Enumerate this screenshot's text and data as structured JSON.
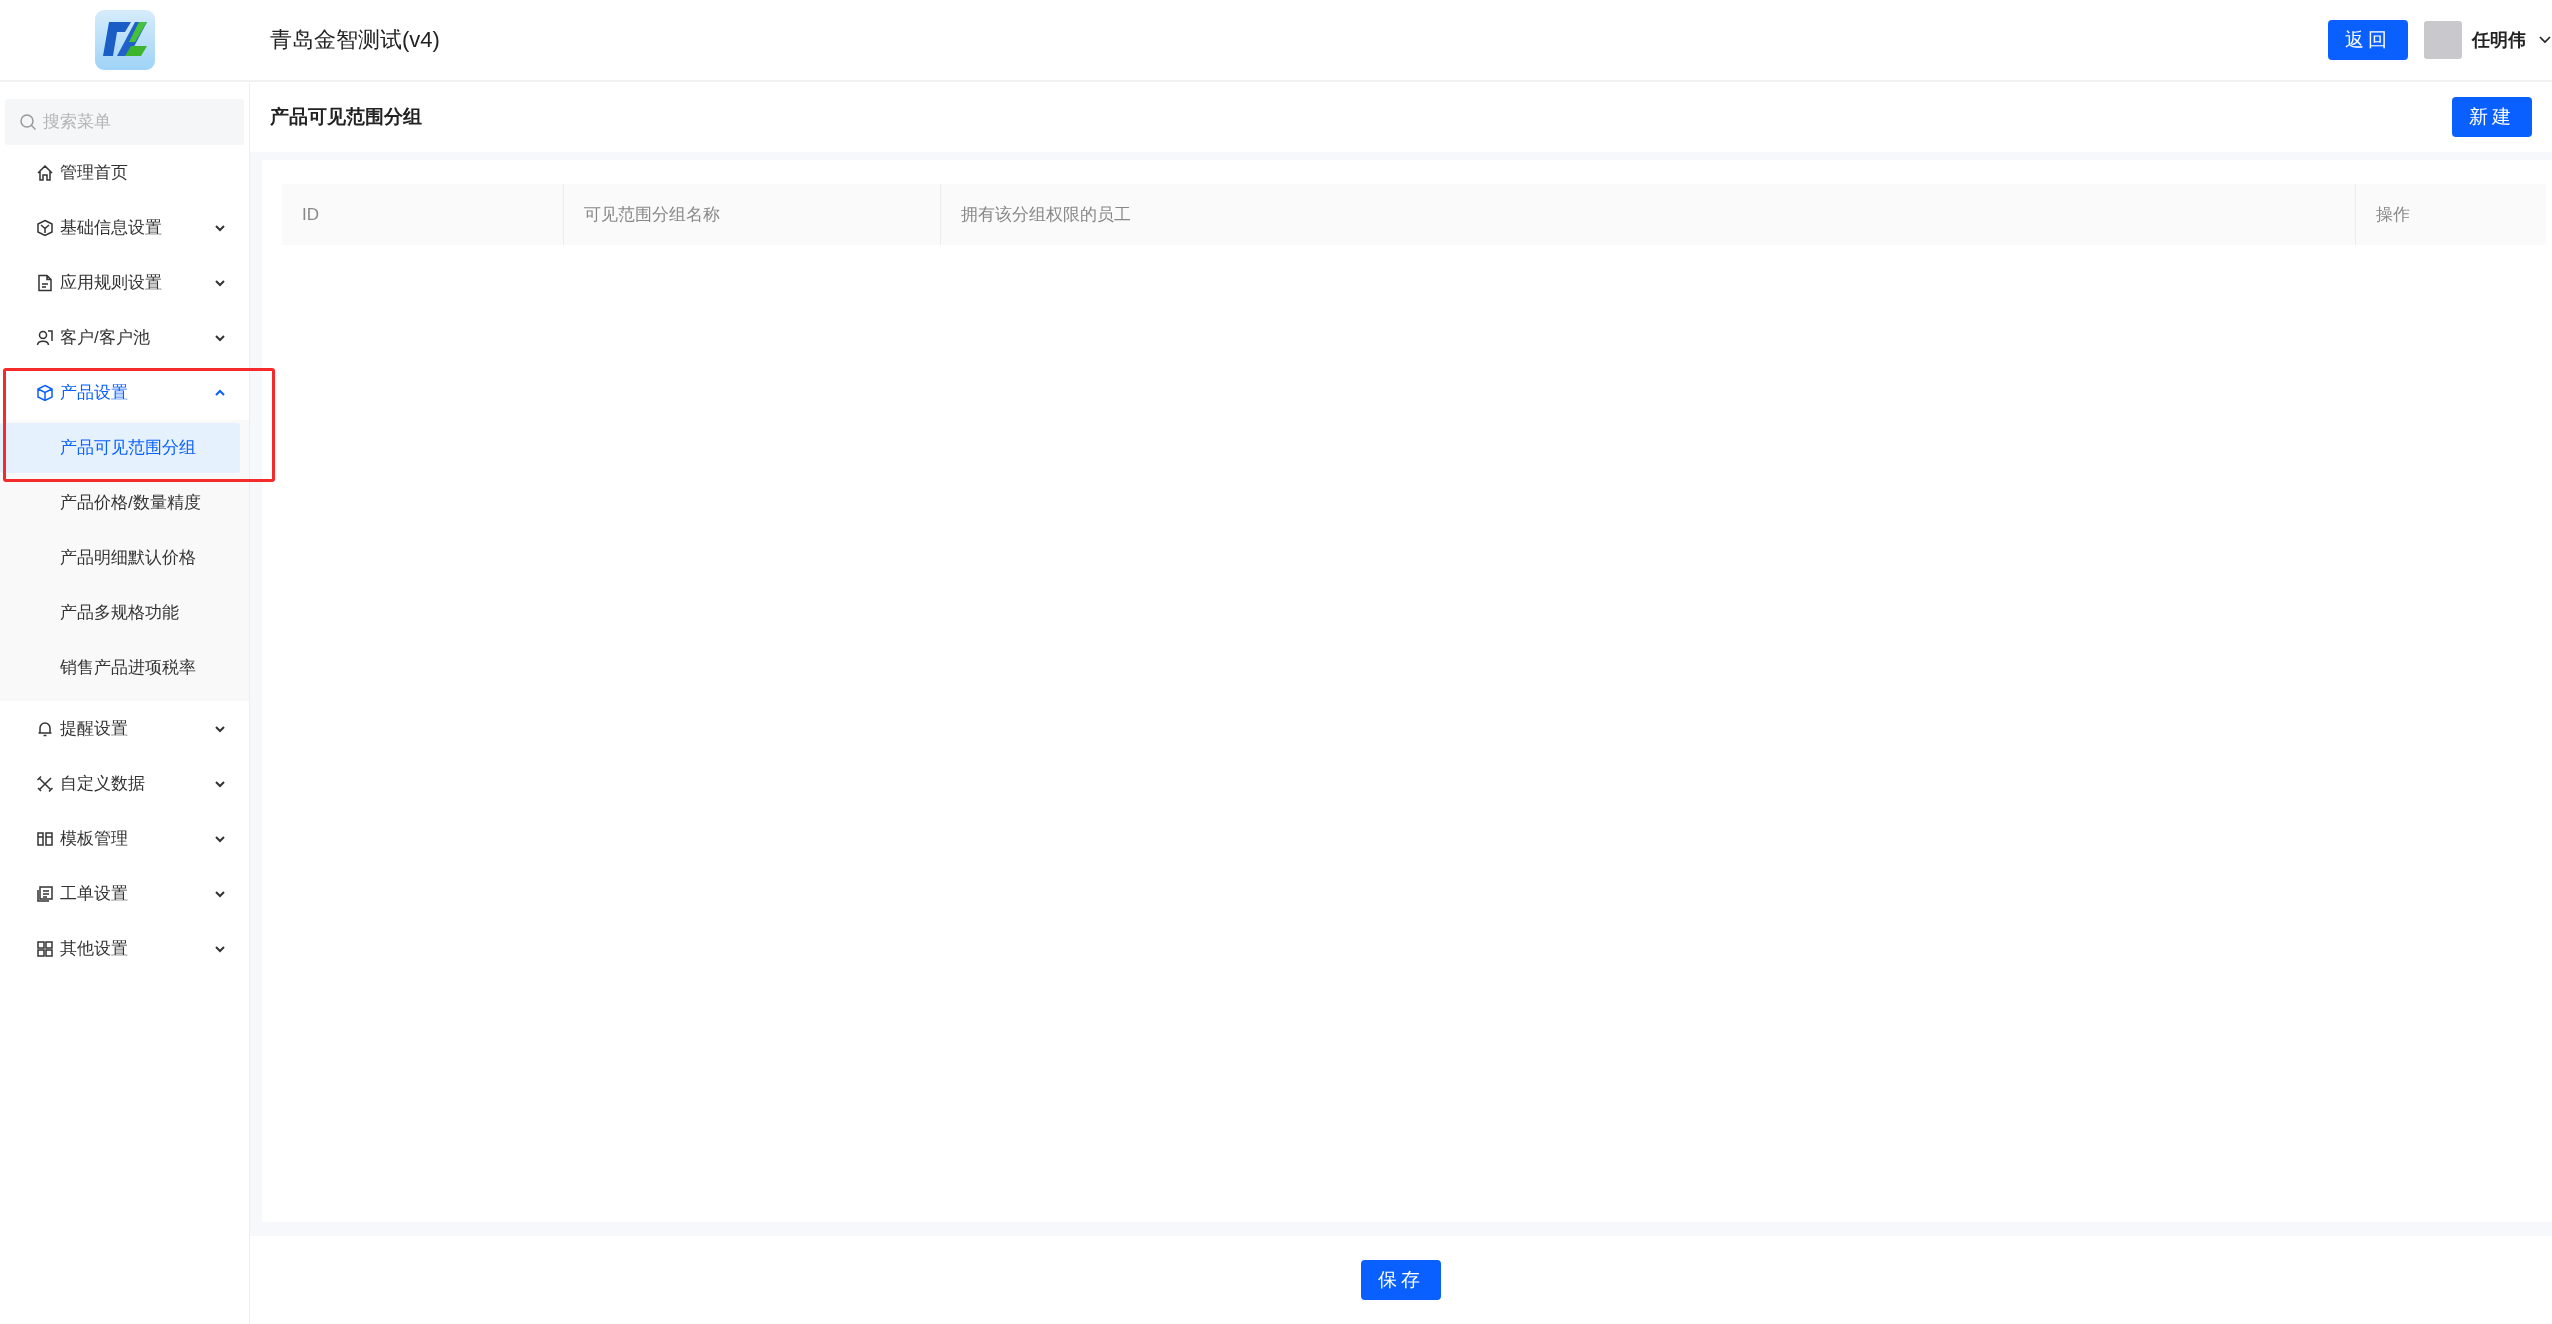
{
  "header": {
    "app_title": "青岛金智测试(v4)",
    "back_button": "返回",
    "user": {
      "name": "任明伟"
    }
  },
  "sidebar": {
    "search": {
      "placeholder": "搜索菜单"
    },
    "items": [
      {
        "label": "管理首页",
        "kind": "link",
        "selected": false
      },
      {
        "label": "基础信息设置",
        "kind": "group",
        "expanded": false,
        "selected": false
      },
      {
        "label": "应用规则设置",
        "kind": "group",
        "expanded": false,
        "selected": false
      },
      {
        "label": "客户/客户池",
        "kind": "group",
        "expanded": false,
        "selected": false
      },
      {
        "label": "产品设置",
        "kind": "group",
        "expanded": true,
        "selected": true,
        "highlighted": true,
        "children": [
          {
            "label": "产品可见范围分组",
            "selected": true
          },
          {
            "label": "产品价格/数量精度",
            "selected": false
          },
          {
            "label": "产品明细默认价格",
            "selected": false
          },
          {
            "label": "产品多规格功能",
            "selected": false
          },
          {
            "label": "销售产品进项税率",
            "selected": false
          }
        ]
      },
      {
        "label": "提醒设置",
        "kind": "group",
        "expanded": false,
        "selected": false
      },
      {
        "label": "自定义数据",
        "kind": "group",
        "expanded": false,
        "selected": false
      },
      {
        "label": "模板管理",
        "kind": "group",
        "expanded": false,
        "selected": false
      },
      {
        "label": "工单设置",
        "kind": "group",
        "expanded": false,
        "selected": false
      },
      {
        "label": "其他设置",
        "kind": "group",
        "expanded": false,
        "selected": false
      }
    ]
  },
  "page": {
    "title": "产品可见范围分组",
    "new_button": "新建",
    "table": {
      "columns": [
        "ID",
        "可见范围分组名称",
        "拥有该分组权限的员工",
        "操作"
      ]
    }
  },
  "footer": {
    "save_button": "保存"
  }
}
